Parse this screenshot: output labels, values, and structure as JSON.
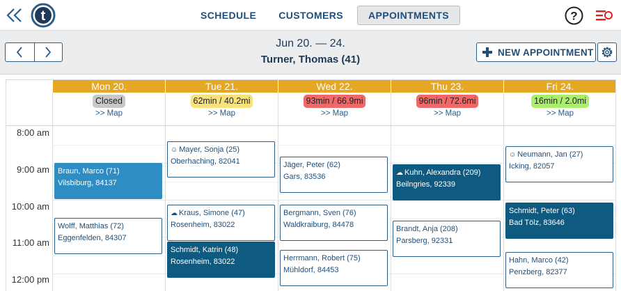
{
  "nav": {
    "tabs": [
      "SCHEDULE",
      "CUSTOMERS",
      "APPOINTMENTS"
    ],
    "active_tab": "APPOINTMENTS",
    "logo_letter": "t",
    "help_symbol": "?"
  },
  "header": {
    "date_range": "Jun 20. — 24.",
    "employee": "Turner, Thomas (41)",
    "new_appointment_label": "NEW APPOINTMENT"
  },
  "colors": {
    "accent": "#1f4e79",
    "day_header": "#e5a824",
    "appointment_light": "#2e8dc2",
    "appointment_dark": "#0e5a80",
    "badge_gray": "#c8c8c8",
    "badge_yellow": "#f9e27a",
    "badge_red": "#f26767",
    "badge_green": "#a9ef6a"
  },
  "days": [
    {
      "label": "Mon 20.",
      "badge": "Closed",
      "badge_color": "#c8c8c8",
      "map": ">> Map"
    },
    {
      "label": "Tue 21.",
      "badge": "62min / 40.2mi",
      "badge_color": "#f9e27a",
      "map": ">> Map"
    },
    {
      "label": "Wed 22.",
      "badge": "93min / 66.9mi",
      "badge_color": "#f26767",
      "map": ">> Map"
    },
    {
      "label": "Thu 23.",
      "badge": "96min / 72.6mi",
      "badge_color": "#f26767",
      "map": ">> Map"
    },
    {
      "label": "Fri 24.",
      "badge": "16min / 2.0mi",
      "badge_color": "#a9ef6a",
      "map": ">> Map"
    }
  ],
  "times": [
    "8:00 am",
    "9:00 am",
    "10:00 am",
    "11:00 am",
    "12:00 pm"
  ],
  "appointments": [
    {
      "day": 0,
      "name": "Braun, Marco (71)",
      "place": "Vilsbiburg, 84137",
      "style": "light",
      "icon": ""
    },
    {
      "day": 0,
      "name": "Wolff, Matthias (72)",
      "place": "Eggenfelden, 84307",
      "style": "outline",
      "icon": ""
    },
    {
      "day": 1,
      "name": "Mayer, Sonja (25)",
      "place": "Oberhaching, 82041",
      "style": "outline",
      "icon": "☺"
    },
    {
      "day": 1,
      "name": "Kraus, Simone (47)",
      "place": "Rosenheim, 83022",
      "style": "outline",
      "icon": "☁"
    },
    {
      "day": 1,
      "name": "Schmidt, Katrin (48)",
      "place": "Rosenheim, 83022",
      "style": "dark",
      "icon": ""
    },
    {
      "day": 2,
      "name": "Jäger, Peter (62)",
      "place": "Gars, 83536",
      "style": "outline",
      "icon": ""
    },
    {
      "day": 2,
      "name": "Bergmann, Sven (76)",
      "place": "Waldkraiburg, 84478",
      "style": "outline",
      "icon": ""
    },
    {
      "day": 2,
      "name": "Herrmann, Robert (75)",
      "place": "Mühldorf, 84453",
      "style": "outline",
      "icon": ""
    },
    {
      "day": 3,
      "name": "Kuhn, Alexandra (209)",
      "place": "Beilngries, 92339",
      "style": "dark",
      "icon": "☁"
    },
    {
      "day": 3,
      "name": "Brandt, Anja (208)",
      "place": "Parsberg, 92331",
      "style": "outline",
      "icon": ""
    },
    {
      "day": 4,
      "name": "Neumann, Jan (27)",
      "place": "Icking, 82057",
      "style": "outline",
      "icon": "☺"
    },
    {
      "day": 4,
      "name": "Schmidt, Peter (63)",
      "place": "Bad Tölz, 83646",
      "style": "dark",
      "icon": ""
    },
    {
      "day": 4,
      "name": "Hahn, Marco (42)",
      "place": "Penzberg, 82377",
      "style": "outline",
      "icon": ""
    }
  ]
}
